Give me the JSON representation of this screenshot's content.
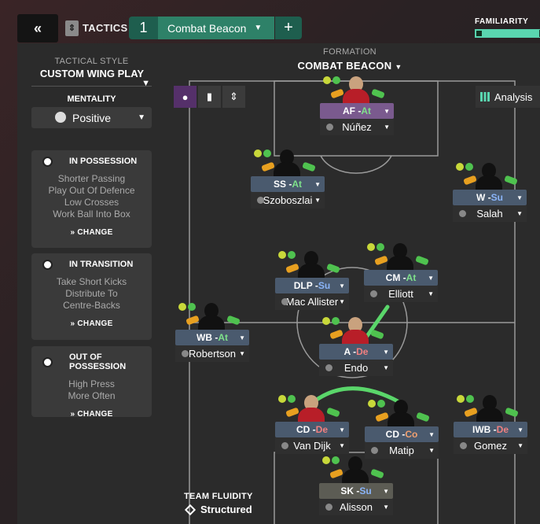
{
  "header": {
    "back_icon": "double-chevron-left-icon",
    "section_title": "TACTICS",
    "tab_number": "1",
    "tab_name": "Combat Beacon",
    "add_label": "+",
    "familiarity_label": "FAMILIARITY",
    "familiarity_fraction": 0.92
  },
  "left": {
    "tactical_style_label": "TACTICAL STYLE",
    "tactical_style_value": "CUSTOM WING PLAY",
    "mentality_label": "MENTALITY",
    "mentality_value": "Positive",
    "in_possession": {
      "title": "IN POSSESSION",
      "items": [
        "Shorter Passing",
        "Play Out Of Defence",
        "Low Crosses",
        "Work Ball Into Box"
      ],
      "change": "CHANGE"
    },
    "in_transition": {
      "title": "IN TRANSITION",
      "items": [
        "Take Short Kicks",
        "Distribute To",
        "Centre-Backs"
      ],
      "change": "CHANGE"
    },
    "out_of_possession": {
      "title": "OUT OF POSSESSION",
      "items": [
        "High Press",
        "More Often"
      ],
      "change": "CHANGE"
    }
  },
  "pitch": {
    "formation_label": "FORMATION",
    "formation_value": "COMBAT BEACON",
    "analysis_label": "Analysis",
    "fluidity_label": "TEAM FLUIDITY",
    "fluidity_value": "Structured",
    "colors": {
      "attack": "#7ee08a",
      "support": "#8ab4f8",
      "defend": "#f08080",
      "cover": "#f0a070",
      "role_bg": "#4a5a6e",
      "gk_bg": "#5c5c54",
      "link": "#5ad66a"
    },
    "players": [
      {
        "role": "AF",
        "duty": "At",
        "name": "Núñez"
      },
      {
        "role": "SS",
        "duty": "At",
        "name": "Szoboszlai"
      },
      {
        "role": "W",
        "duty": "Su",
        "name": "Salah"
      },
      {
        "role": "CM",
        "duty": "At",
        "name": "Elliott"
      },
      {
        "role": "DLP",
        "duty": "Su",
        "name": "Mac Allister"
      },
      {
        "role": "WB",
        "duty": "At",
        "name": "Robertson"
      },
      {
        "role": "A",
        "duty": "De",
        "name": "Endo"
      },
      {
        "role": "CD",
        "duty": "De",
        "name": "Van Dijk"
      },
      {
        "role": "CD",
        "duty": "Co",
        "name": "Matip"
      },
      {
        "role": "IWB",
        "duty": "De",
        "name": "Gomez"
      },
      {
        "role": "SK",
        "duty": "Su",
        "name": "Alisson"
      }
    ]
  }
}
